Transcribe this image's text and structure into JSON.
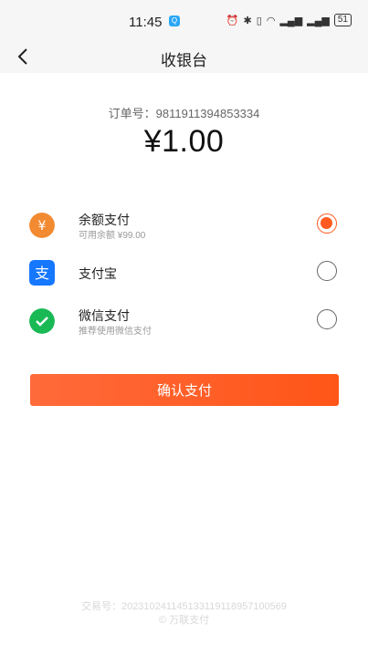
{
  "status": {
    "time": "11:45",
    "app_icon": "Q",
    "battery": "51"
  },
  "header": {
    "title": "收银台"
  },
  "order": {
    "label": "订单号：",
    "number": "9811911394853334"
  },
  "amount": "¥1.00",
  "payment_methods": [
    {
      "name": "余额支付",
      "sub": "可用余额 ¥99.00",
      "icon": "yen-coin-icon",
      "color": "#f28a31",
      "selected": true
    },
    {
      "name": "支付宝",
      "sub": "",
      "icon": "alipay-icon",
      "color": "#1677ff",
      "selected": false
    },
    {
      "name": "微信支付",
      "sub": "推荐使用微信支付",
      "icon": "wechat-pay-icon",
      "color": "#19b955",
      "selected": false
    }
  ],
  "confirm_label": "确认支付",
  "footer": {
    "trade_label": "交易号：",
    "trade_number": "20231024114513311911895710​0569",
    "copyright": "© 万联支付"
  }
}
